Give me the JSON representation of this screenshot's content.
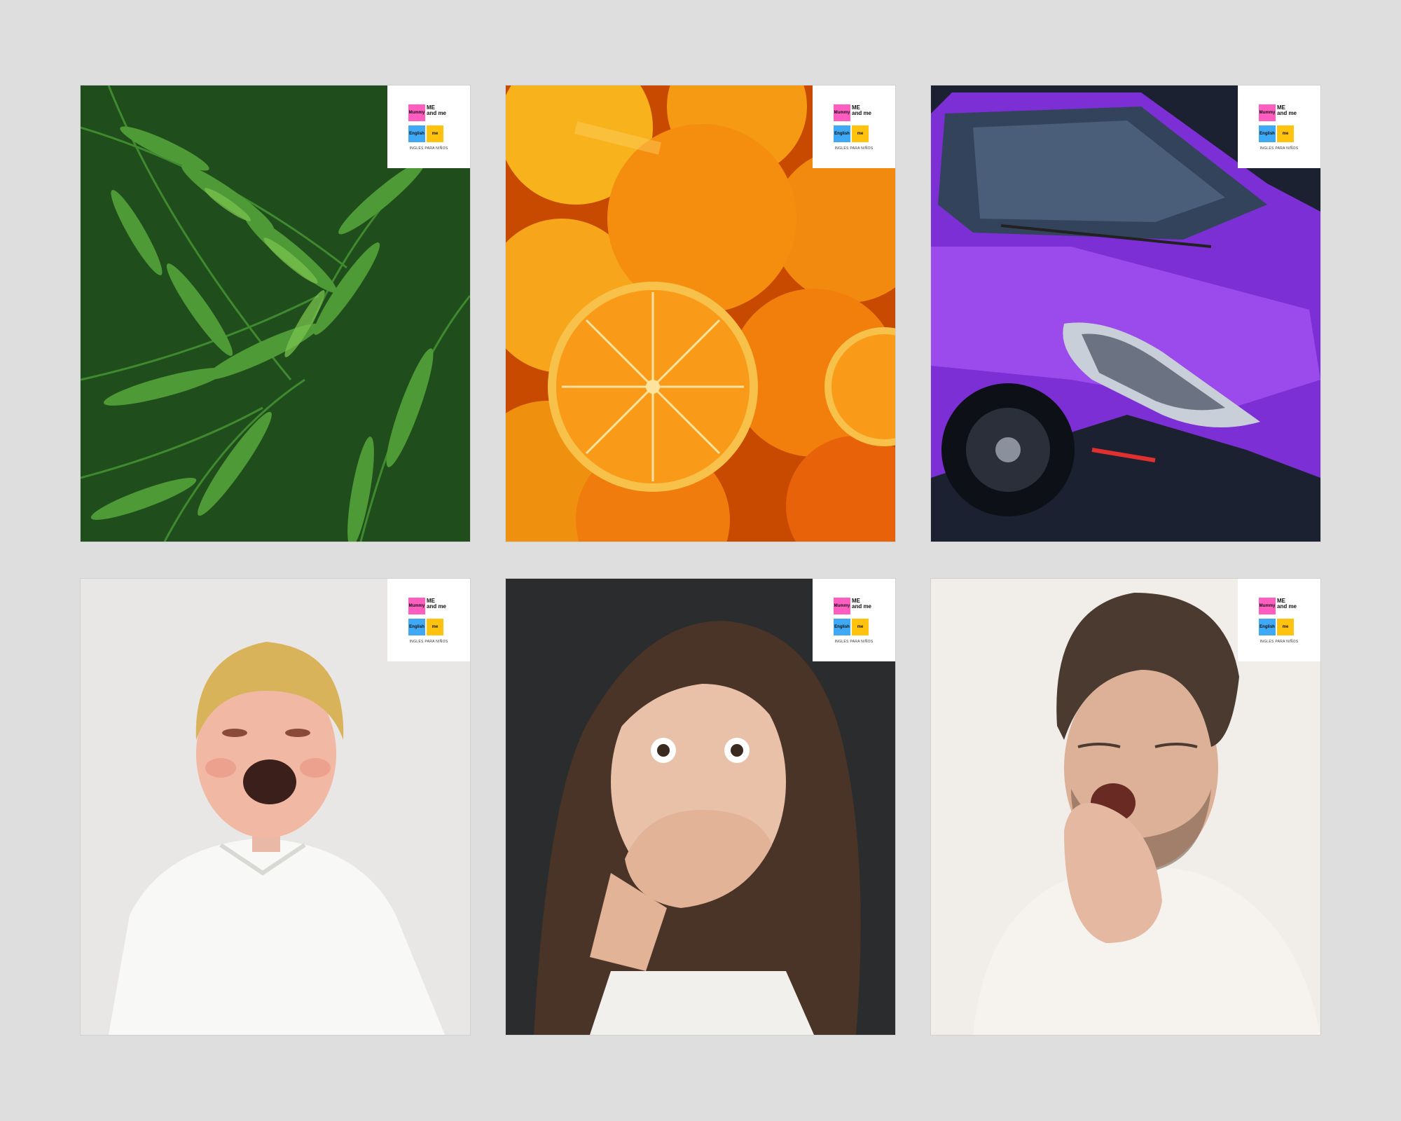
{
  "brand": {
    "tile_pink": "Mummy",
    "tile_text": "ME and me",
    "tile_blue": "English",
    "tile_yellow": "me",
    "tagline": "INGLÉS PARA NIÑOS",
    "colors": {
      "pink": "#ff5ec0",
      "blue": "#3fa9f5",
      "yellow": "#ffc20e"
    }
  },
  "cards": [
    {
      "subject": "fern-leaves"
    },
    {
      "subject": "oranges"
    },
    {
      "subject": "purple-car"
    },
    {
      "subject": "crying-boy"
    },
    {
      "subject": "surprised-woman"
    },
    {
      "subject": "yawning-man"
    }
  ]
}
